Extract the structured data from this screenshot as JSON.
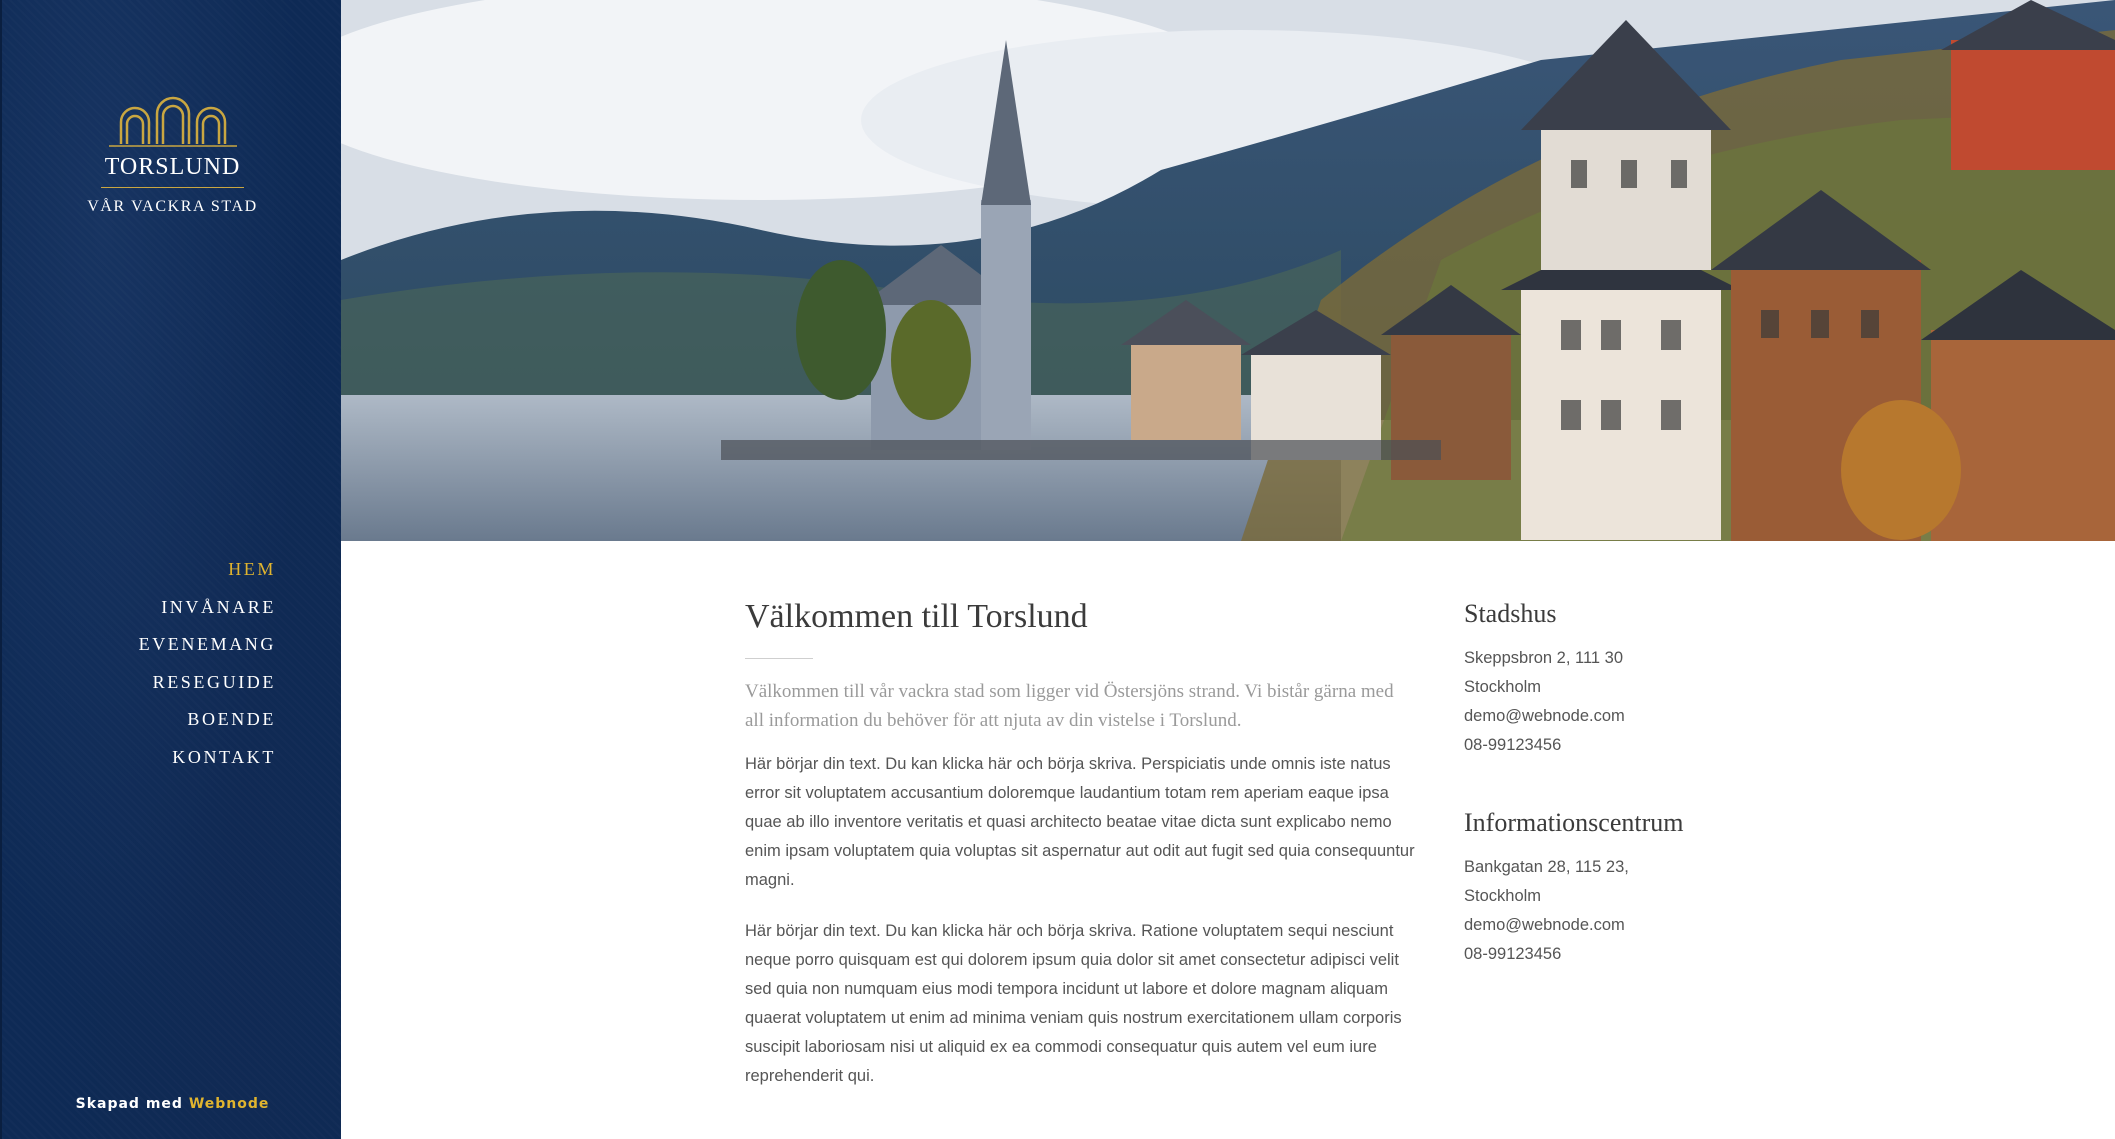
{
  "sidebar": {
    "logo": {
      "name": "TORSLUND",
      "tagline": "VÅR VACKRA STAD",
      "accent_color": "#c9a640"
    },
    "nav": [
      {
        "label": "HEM",
        "active": true
      },
      {
        "label": "INVÅNARE",
        "active": false
      },
      {
        "label": "EVENEMANG",
        "active": false
      },
      {
        "label": "RESEGUIDE",
        "active": false
      },
      {
        "label": "BOENDE",
        "active": false
      },
      {
        "label": "KONTAKT",
        "active": false
      }
    ],
    "credit": {
      "prefix": "Skapad med",
      "brand": "Webnode"
    },
    "background_color": "#0e2a55",
    "active_color": "#e0b42e"
  },
  "hero": {
    "image": "lakeside-alpine-village-photo"
  },
  "main": {
    "title": "Välkommen till Torslund",
    "lead": "Välkommen till vår vackra stad som ligger vid Östersjöns strand. Vi bistår gärna med all information du behöver för att njuta av din vistelse i Torslund.",
    "paragraphs": [
      "Här börjar din text. Du kan klicka här och börja skriva. Perspiciatis unde omnis iste natus error sit voluptatem accusantium doloremque laudantium totam rem aperiam eaque ipsa quae ab illo inventore veritatis et quasi architecto beatae vitae dicta sunt explicabo nemo enim ipsam voluptatem quia voluptas sit aspernatur aut odit aut fugit sed quia consequuntur magni.",
      "Här börjar din text. Du kan klicka här och börja skriva. Ratione voluptatem sequi nesciunt neque porro quisquam est qui dolorem ipsum quia dolor sit amet consectetur adipisci velit sed quia non numquam eius modi tempora incidunt ut labore et dolore magnam aliquam quaerat voluptatem ut enim ad minima veniam quis nostrum exercitationem ullam corporis suscipit laboriosam nisi ut aliquid ex ea commodi consequatur quis autem vel eum iure reprehenderit qui."
    ]
  },
  "aside": {
    "blocks": [
      {
        "title": "Stadshus",
        "lines": [
          "Skeppsbron 2, 111 30",
          "Stockholm",
          "demo@webnode.com",
          "08-99123456"
        ]
      },
      {
        "title": "Informationscentrum",
        "lines": [
          "Bankgatan 28, 115 23,",
          "Stockholm",
          "demo@webnode.com",
          "08-99123456"
        ]
      }
    ]
  }
}
